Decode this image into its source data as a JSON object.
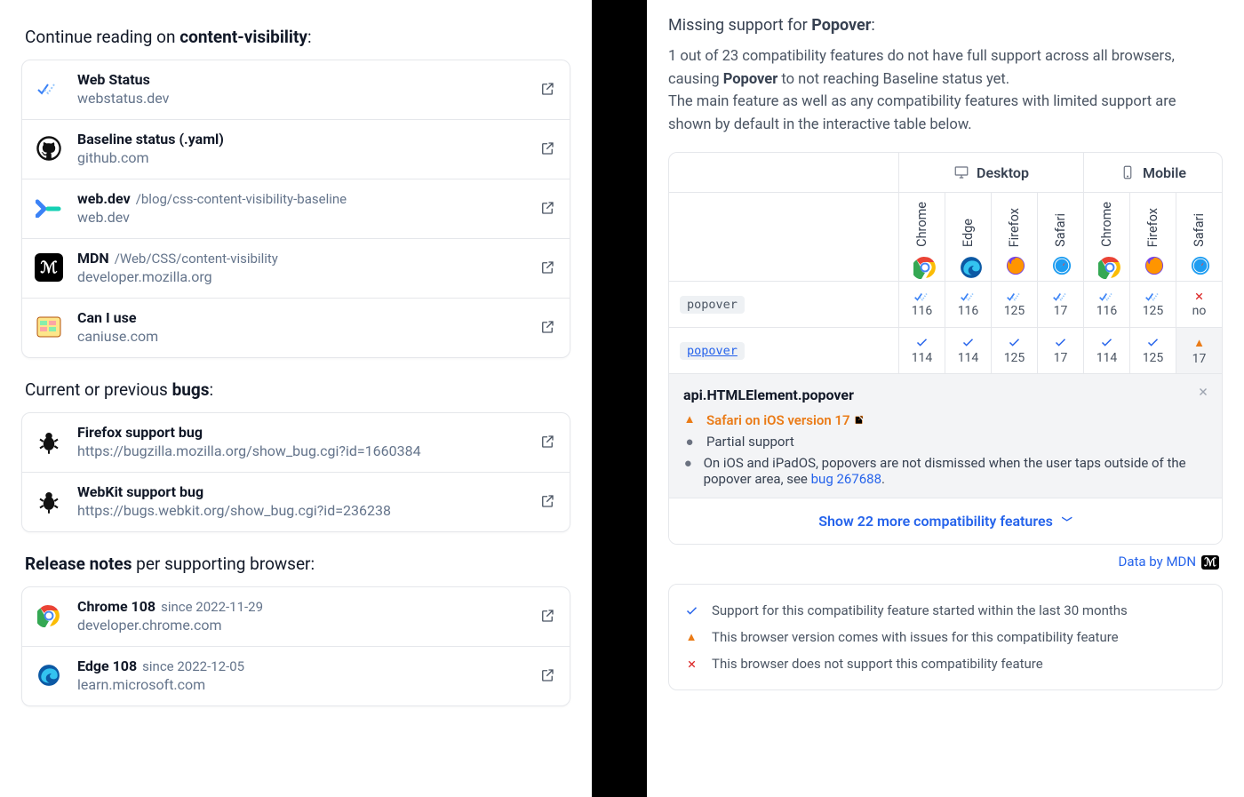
{
  "left": {
    "continue": {
      "heading_pre": "Continue reading on ",
      "heading_bold": "content-visibility",
      "heading_post": ":",
      "items": [
        {
          "title": "Web Status",
          "path": "",
          "subtitle": "webstatus.dev",
          "icon": "webstatus"
        },
        {
          "title": "Baseline status (.yaml)",
          "path": "",
          "subtitle": "github.com",
          "icon": "github"
        },
        {
          "title": "web.dev",
          "path": "/blog/css-content-visibility-baseline",
          "subtitle": "web.dev",
          "icon": "webdev"
        },
        {
          "title": "MDN",
          "path": "/Web/CSS/content-visibility",
          "subtitle": "developer.mozilla.org",
          "icon": "mdn"
        },
        {
          "title": "Can I use",
          "path": "",
          "subtitle": "caniuse.com",
          "icon": "caniuse"
        }
      ]
    },
    "bugs": {
      "heading_pre": "Current or previous ",
      "heading_bold": "bugs",
      "heading_post": ":",
      "items": [
        {
          "title": "Firefox support bug",
          "url": "https://bugzilla.mozilla.org/show_bug.cgi?id=1660384"
        },
        {
          "title": "WebKit support bug",
          "url": "https://bugs.webkit.org/show_bug.cgi?id=236238"
        }
      ]
    },
    "releases": {
      "heading_bold": "Release notes",
      "heading_post": " per supporting browser:",
      "items": [
        {
          "title": "Chrome 108",
          "since": "since 2022-11-29",
          "subtitle": "developer.chrome.com",
          "icon": "chrome"
        },
        {
          "title": "Edge 108",
          "since": "since 2022-12-05",
          "subtitle": "learn.microsoft.com",
          "icon": "edge"
        }
      ]
    }
  },
  "right": {
    "heading_pre": "Missing support for ",
    "heading_bold": "Popover",
    "heading_post": ":",
    "para1a": "1 out of 23 compatibility features do not have full support across all browsers, causing ",
    "para1b": "Popover",
    "para1c": " to not reaching Baseline status yet.",
    "para2": "The main feature as well as any compatibility features with limited support are shown by default in the interactive table below.",
    "table": {
      "groups": [
        {
          "name": "Desktop",
          "cols": 4
        },
        {
          "name": "Mobile",
          "cols": 3
        }
      ],
      "browsers": [
        "Chrome",
        "Edge",
        "Firefox",
        "Safari",
        "Chrome",
        "Firefox",
        "Safari"
      ],
      "rows": [
        {
          "label": "popover",
          "link": false,
          "cells": [
            {
              "m": "dcheck",
              "v": "116"
            },
            {
              "m": "dcheck",
              "v": "116"
            },
            {
              "m": "dcheck",
              "v": "125"
            },
            {
              "m": "dcheck",
              "v": "17"
            },
            {
              "m": "dcheck",
              "v": "116"
            },
            {
              "m": "dcheck",
              "v": "125"
            },
            {
              "m": "cross",
              "v": "no"
            }
          ]
        },
        {
          "label": "popover",
          "link": true,
          "cells": [
            {
              "m": "check",
              "v": "114"
            },
            {
              "m": "check",
              "v": "114"
            },
            {
              "m": "check",
              "v": "125"
            },
            {
              "m": "check",
              "v": "17"
            },
            {
              "m": "check",
              "v": "114"
            },
            {
              "m": "check",
              "v": "125"
            },
            {
              "m": "warn",
              "v": "17",
              "active": true
            }
          ]
        }
      ],
      "detail": {
        "title": "api.HTMLElement.popover",
        "warn_label": "Safari on iOS version 17",
        "partial": "Partial support",
        "note_pre": "On iOS and iPadOS, popovers are not dismissed when the user taps outside of the popover area, see ",
        "note_link": "bug 267688",
        "note_post": "."
      },
      "showmore": "Show 22 more compatibility features"
    },
    "databy": "Data by MDN",
    "legend": [
      {
        "m": "check",
        "t": "Support for this compatibility feature started within the last 30 months"
      },
      {
        "m": "warn",
        "t": "This browser version comes with issues for this compatibility feature"
      },
      {
        "m": "cross",
        "t": "This browser does not support this compatibility feature"
      }
    ]
  }
}
